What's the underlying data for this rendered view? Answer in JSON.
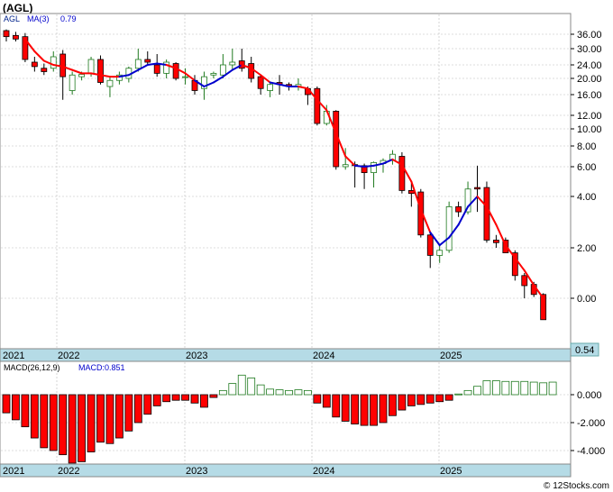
{
  "header": {
    "symbol_title": "(AGL)"
  },
  "price_panel": {
    "legend_symbol": "AGL",
    "legend_ma": "MA(3)",
    "legend_ma_value": "0.79",
    "last_price_label": "0.54"
  },
  "macd_panel": {
    "legend_params": "MACD(26,12,9)",
    "legend_label": "MACD:0.851"
  },
  "footer": {
    "watermark": "© 12Stocks.com"
  },
  "colors": {
    "up_candle": "#1f7a1f",
    "down_candle": "#ff0000",
    "ma_up": "#0000cc",
    "ma_down": "#ff0000",
    "macd_pos": "#1f7a1f",
    "macd_neg": "#ff0000",
    "date_strip": "#b5dbe6",
    "grid": "#bbbbbb"
  },
  "chart_data": [
    {
      "type": "candlestick",
      "title": "(AGL)",
      "x_tick_labels": [
        "2021",
        "2022",
        "2023",
        "2024",
        "2025"
      ],
      "y_tick_labels": [
        "36.00",
        "30.00",
        "24.00",
        "20.00",
        "16.00",
        "12.00",
        "10.00",
        "8.00",
        "6.00",
        "4.00",
        "2.00",
        "0.00"
      ],
      "y_scale": "log-like (as printed)",
      "grid": "on",
      "last_value": 0.54,
      "bars": [
        {
          "o": 37.5,
          "h": 38,
          "l": 33,
          "c": 35,
          "ma": null,
          "trend": "down"
        },
        {
          "o": 35.5,
          "h": 37,
          "l": 33,
          "c": 34,
          "ma": null,
          "trend": "down"
        },
        {
          "o": 35,
          "h": 36.5,
          "l": 25,
          "c": 26,
          "ma": 34,
          "trend": "down"
        },
        {
          "o": 25,
          "h": 27,
          "l": 22,
          "c": 23.5,
          "ma": 29,
          "trend": "down"
        },
        {
          "o": 23,
          "h": 24.5,
          "l": 21,
          "c": 22,
          "ma": 25.5,
          "trend": "down"
        },
        {
          "o": 23,
          "h": 29,
          "l": 22,
          "c": 27,
          "ma": 24,
          "trend": "down"
        },
        {
          "o": 28,
          "h": 29.5,
          "l": 15,
          "c": 20.5,
          "ma": 23.5,
          "trend": "down"
        },
        {
          "o": 17,
          "h": 22,
          "l": 16,
          "c": 21,
          "ma": 22.5,
          "trend": "down"
        },
        {
          "o": 20.5,
          "h": 22,
          "l": 19.5,
          "c": 21.2,
          "ma": 21.5,
          "trend": "down"
        },
        {
          "o": 21.5,
          "h": 27,
          "l": 20.5,
          "c": 26,
          "ma": 21.5,
          "trend": "down"
        },
        {
          "o": 26,
          "h": 27.5,
          "l": 18.5,
          "c": 19,
          "ma": 21,
          "trend": "down"
        },
        {
          "o": 18,
          "h": 20.5,
          "l": 15.5,
          "c": 19.5,
          "ma": 20.5,
          "trend": "down"
        },
        {
          "o": 19.5,
          "h": 22,
          "l": 18.5,
          "c": 21,
          "ma": 20.5,
          "trend": "down"
        },
        {
          "o": 20,
          "h": 23.5,
          "l": 19,
          "c": 23,
          "ma": 21,
          "trend": "up"
        },
        {
          "o": 23,
          "h": 30,
          "l": 22,
          "c": 26,
          "ma": 22.5,
          "trend": "up"
        },
        {
          "o": 26,
          "h": 29,
          "l": 24,
          "c": 25,
          "ma": 24,
          "trend": "up"
        },
        {
          "o": 24,
          "h": 28,
          "l": 20.5,
          "c": 21.5,
          "ma": 24.5,
          "trend": "up"
        },
        {
          "o": 21.5,
          "h": 26,
          "l": 20,
          "c": 25,
          "ma": 24,
          "trend": "up"
        },
        {
          "o": 24.5,
          "h": 25,
          "l": 19.5,
          "c": 20,
          "ma": 23,
          "trend": "down"
        },
        {
          "o": 20.5,
          "h": 23,
          "l": 18.5,
          "c": 20.5,
          "ma": 21.5,
          "trend": "down"
        },
        {
          "o": 19.5,
          "h": 21,
          "l": 16,
          "c": 17,
          "ma": 19.5,
          "trend": "down"
        },
        {
          "o": 17.5,
          "h": 22,
          "l": 15,
          "c": 20.5,
          "ma": 18,
          "trend": "up"
        },
        {
          "o": 21,
          "h": 22,
          "l": 20,
          "c": 21.5,
          "ma": 19,
          "trend": "up"
        },
        {
          "o": 21,
          "h": 28,
          "l": 20,
          "c": 24,
          "ma": 20.5,
          "trend": "up"
        },
        {
          "o": 24,
          "h": 30,
          "l": 22.5,
          "c": 25,
          "ma": 22.5,
          "trend": "up"
        },
        {
          "o": 25.5,
          "h": 30,
          "l": 22,
          "c": 23,
          "ma": 24,
          "trend": "up"
        },
        {
          "o": 24.5,
          "h": 27,
          "l": 19,
          "c": 20,
          "ma": 23,
          "trend": "down"
        },
        {
          "o": 20.5,
          "h": 21,
          "l": 16,
          "c": 17.5,
          "ma": 21,
          "trend": "down"
        },
        {
          "o": 17,
          "h": 19,
          "l": 15.5,
          "c": 18.5,
          "ma": 19,
          "trend": "down"
        },
        {
          "o": 19,
          "h": 21,
          "l": 16,
          "c": 18.5,
          "ma": 18.5,
          "trend": "up"
        },
        {
          "o": 18.5,
          "h": 19,
          "l": 17,
          "c": 18,
          "ma": 18,
          "trend": "up"
        },
        {
          "o": 18,
          "h": 20,
          "l": 17,
          "c": 18.5,
          "ma": 18,
          "trend": "up"
        },
        {
          "o": 17.5,
          "h": 18,
          "l": 14,
          "c": 16,
          "ma": 17.5,
          "trend": "down"
        },
        {
          "o": 17.5,
          "h": 18,
          "l": 10.5,
          "c": 10.8,
          "ma": 15,
          "trend": "down"
        },
        {
          "o": 10.8,
          "h": 14,
          "l": 10.5,
          "c": 12.8,
          "ma": 13,
          "trend": "down"
        },
        {
          "o": 12.8,
          "h": 13,
          "l": 5.8,
          "c": 6,
          "ma": 9.5,
          "trend": "down"
        },
        {
          "o": 6,
          "h": 7.8,
          "l": 5.8,
          "c": 6.2,
          "ma": 7,
          "trend": "down"
        },
        {
          "o": 6.2,
          "h": 6.5,
          "l": 4.6,
          "c": 6.1,
          "ma": 6.1,
          "trend": "down"
        },
        {
          "o": 6.1,
          "h": 6.3,
          "l": 4.5,
          "c": 5.6,
          "ma": 6,
          "trend": "up"
        },
        {
          "o": 5.6,
          "h": 6.5,
          "l": 4.6,
          "c": 6.4,
          "ma": 6.1,
          "trend": "up"
        },
        {
          "o": 6.3,
          "h": 6.8,
          "l": 5.6,
          "c": 6.6,
          "ma": 6.3,
          "trend": "up"
        },
        {
          "o": 6.6,
          "h": 7.6,
          "l": 6.2,
          "c": 7.2,
          "ma": 6.7,
          "trend": "up"
        },
        {
          "o": 7,
          "h": 7.4,
          "l": 4.2,
          "c": 4.4,
          "ma": 6.2,
          "trend": "down"
        },
        {
          "o": 4.4,
          "h": 4.9,
          "l": 3.6,
          "c": 4.2,
          "ma": 5,
          "trend": "down"
        },
        {
          "o": 4.3,
          "h": 4.5,
          "l": 2.4,
          "c": 2.5,
          "ma": 3.5,
          "trend": "down"
        },
        {
          "o": 2.5,
          "h": 2.6,
          "l": 1.2,
          "c": 1.7,
          "ma": 2.6,
          "trend": "down"
        },
        {
          "o": 1.7,
          "h": 2.1,
          "l": 1.4,
          "c": 1.9,
          "ma": 2.1,
          "trend": "up"
        },
        {
          "o": 1.9,
          "h": 3.8,
          "l": 1.8,
          "c": 3.6,
          "ma": 2.4,
          "trend": "up"
        },
        {
          "o": 3.6,
          "h": 3.8,
          "l": 3.2,
          "c": 3.4,
          "ma": 2.9,
          "trend": "up"
        },
        {
          "o": 3.4,
          "h": 5,
          "l": 3.3,
          "c": 4.5,
          "ma": 3.6,
          "trend": "up"
        },
        {
          "o": 4.6,
          "h": 6.1,
          "l": 3.4,
          "c": 4.5,
          "ma": 4,
          "trend": "up"
        },
        {
          "o": 4.6,
          "h": 5,
          "l": 2.2,
          "c": 2.3,
          "ma": 3.6,
          "trend": "down"
        },
        {
          "o": 2.3,
          "h": 2.5,
          "l": 2,
          "c": 2.2,
          "ma": 2.9,
          "trend": "down"
        },
        {
          "o": 2.3,
          "h": 2.4,
          "l": 1.8,
          "c": 1.8,
          "ma": 2.1,
          "trend": "down"
        },
        {
          "o": 1.8,
          "h": 1.9,
          "l": 0.7,
          "c": 0.9,
          "ma": 1.6,
          "trend": "down"
        },
        {
          "o": 0.9,
          "h": 1,
          "l": 0.0,
          "c": 0.5,
          "ma": 1.1,
          "trend": "down"
        },
        {
          "o": 0.55,
          "h": 0.65,
          "l": 0.05,
          "c": 0.15,
          "ma": 0.52,
          "trend": "down"
        },
        {
          "o": 0.15,
          "h": 0.2,
          "l": -0.85,
          "c": -0.85,
          "ma": 0.0,
          "trend": "down"
        }
      ]
    },
    {
      "type": "bar",
      "title": "MACD(26,12,9)",
      "x_tick_labels": [
        "2021",
        "2022",
        "2023",
        "2024",
        "2025"
      ],
      "y_tick_labels": [
        "0.000",
        "-2.000",
        "-4.000"
      ],
      "grid": "on",
      "series": [
        {
          "name": "MACD:0.851",
          "values": [
            -1.3,
            -1.8,
            -2.3,
            -3.1,
            -3.8,
            -4.0,
            -4.3,
            -4.9,
            -4.8,
            -4.1,
            -3.4,
            -3.5,
            -3.1,
            -2.6,
            -2.0,
            -1.4,
            -0.8,
            -0.5,
            -0.4,
            -0.4,
            -0.6,
            -0.9,
            -0.2,
            0.3,
            0.8,
            1.4,
            1.2,
            0.7,
            0.4,
            0.35,
            0.3,
            0.35,
            0.3,
            -0.6,
            -0.9,
            -1.6,
            -1.9,
            -2.1,
            -2.2,
            -2.2,
            -2.0,
            -1.5,
            -1.1,
            -0.8,
            -0.7,
            -0.6,
            -0.5,
            -0.4,
            0.05,
            0.3,
            0.6,
            1.0,
            1.0,
            0.95,
            0.95,
            0.95,
            0.9,
            0.85,
            0.9
          ]
        }
      ]
    }
  ]
}
